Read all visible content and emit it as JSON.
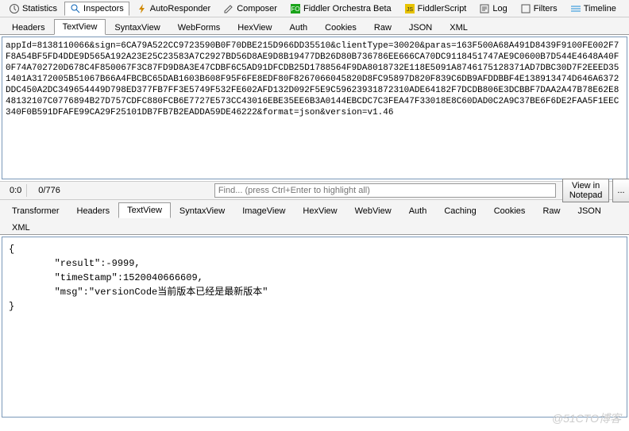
{
  "toolbar": {
    "items": [
      {
        "label": "Statistics",
        "name": "tb-statistics"
      },
      {
        "label": "Inspectors",
        "name": "tb-inspectors",
        "active": true
      },
      {
        "label": "AutoResponder",
        "name": "tb-autoresponder"
      },
      {
        "label": "Composer",
        "name": "tb-composer"
      },
      {
        "label": "Fiddler Orchestra Beta",
        "name": "tb-orchestra"
      },
      {
        "label": "FiddlerScript",
        "name": "tb-fiddlerscript"
      },
      {
        "label": "Log",
        "name": "tb-log"
      },
      {
        "label": "Filters",
        "name": "tb-filters"
      },
      {
        "label": "Timeline",
        "name": "tb-timeline"
      }
    ]
  },
  "reqTabs": [
    "Headers",
    "TextView",
    "SyntaxView",
    "WebForms",
    "HexView",
    "Auth",
    "Cookies",
    "Raw",
    "JSON",
    "XML"
  ],
  "reqActive": "TextView",
  "reqText": "appId=8138110066&sign=6CA79A522CC9723590B0F70DBE215D966DD35510&clientType=30020&paras=163F500A68A491D8439F9100FE002F7F8A54BF5FD4DDE9D565A192A23E25C23583A7C2927BD56D8AE9D8B19477DB26D80B736786EE666CA70DC9118451747AE9C0600B7D544E4648A40F0F74A702720D678C4F850067F3C87FD9D8A3E47CDBF6C5AD91DFCDB25D1788564F9DA8018732E118E5091A8746175128371AD7DBC30D7F2EEED351401A3172005B51067B66A4FBCBC65DAB1603B608F95F6FE8EDF80F8267066045820D8FC95897D820F839C6DB9AFDDBBF4E138913474D646A6372DDC450A2DC349654449D798ED377FB7FF3E5749F532FE602AFD132D092F5E9C59623931872310ADE64182F7DCDB806E3DCBBF7DAA2A47B78E62E848132107C0776894B27D757CDFC880FCB6E7727E573CC43016EBE35EE6B3A0144EBCDC7C3FEA47F33018E8C60DAD0C2A9C37BE6F6DE2FAA5F1EEC340F0B591DFAFE99CA29F25101DB7FB7B2EADDA59DE46222&format=json&version=v1.46",
  "status": {
    "pos": "0:0",
    "sel": "0/776"
  },
  "find": {
    "placeholder": "Find... (press Ctrl+Enter to highlight all)"
  },
  "buttons": {
    "notepad": "View in Notepad",
    "more": "..."
  },
  "respTabs1": [
    "Transformer",
    "Headers",
    "TextView",
    "SyntaxView",
    "ImageView",
    "HexView",
    "WebView",
    "Auth",
    "Caching",
    "Cookies",
    "Raw",
    "JSON"
  ],
  "respTabs2": [
    "XML"
  ],
  "respActive": "TextView",
  "respJson": "{\n        \"result\":-9999,\n        \"timeStamp\":1520040666609,\n        \"msg\":\"versionCode当前版本已经是最新版本\"\n}",
  "watermark": "@51CTO博客"
}
